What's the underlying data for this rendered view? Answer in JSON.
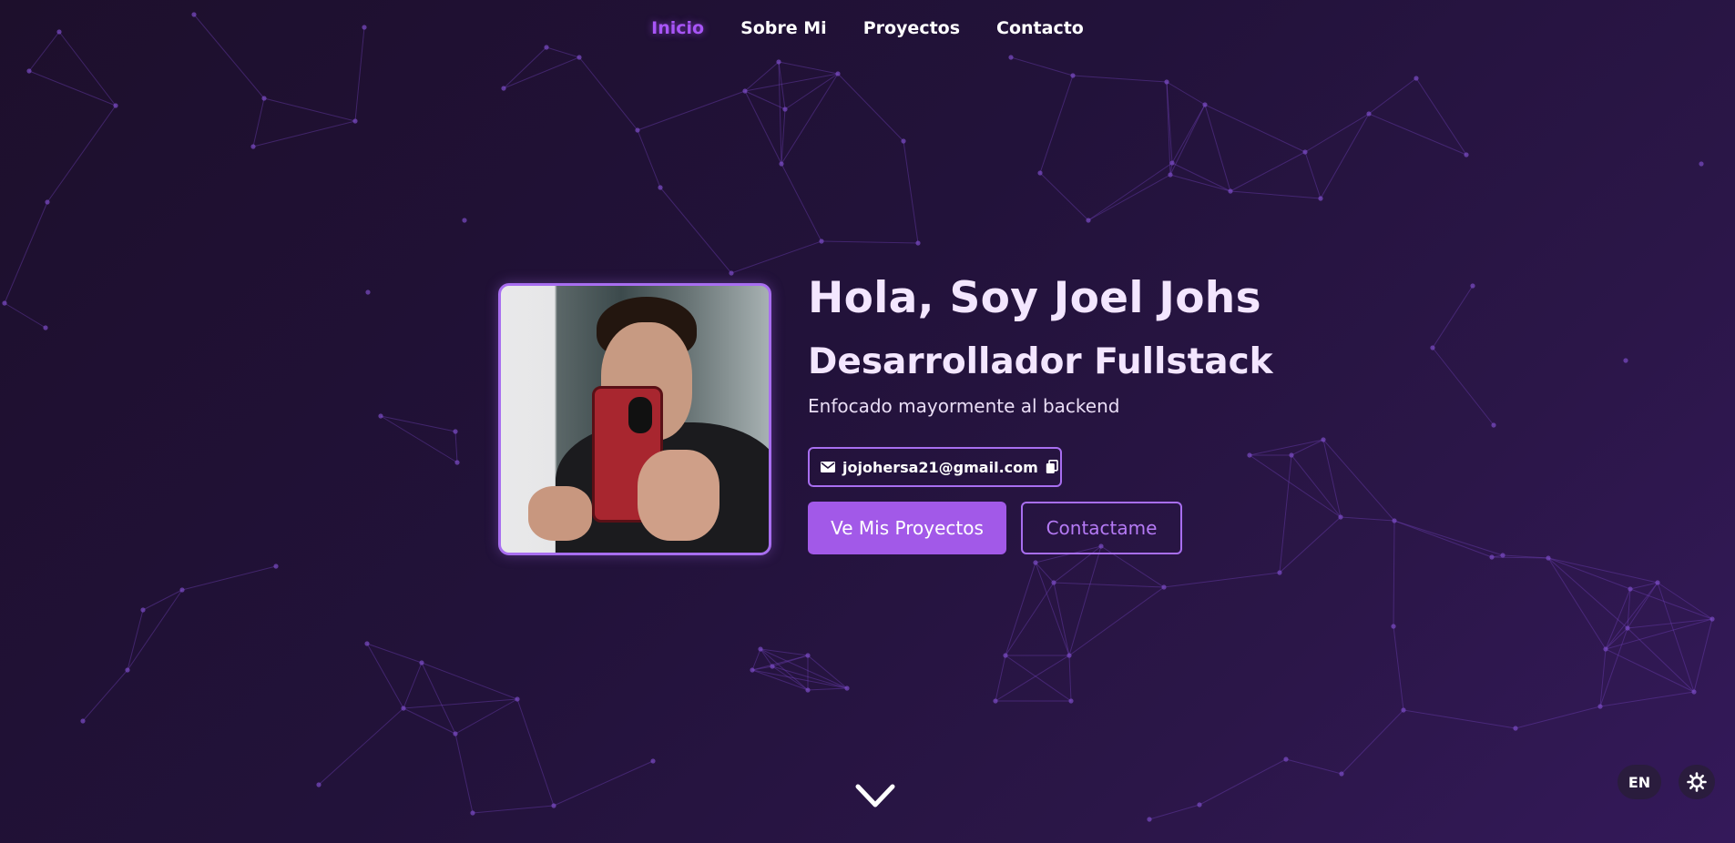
{
  "nav": {
    "items": [
      {
        "label": "Inicio",
        "active": true
      },
      {
        "label": "Sobre Mi",
        "active": false
      },
      {
        "label": "Proyectos",
        "active": false
      },
      {
        "label": "Contacto",
        "active": false
      }
    ]
  },
  "hero": {
    "greeting": "Hola, Soy Joel Johs",
    "role": "Desarrollador Fullstack",
    "tagline": "Enfocado mayormente al backend",
    "email": "jojohersa21@gmail.com",
    "primary_button": "Ve Mis Proyectos",
    "secondary_button": "Contactame"
  },
  "controls": {
    "language_label": "EN"
  },
  "icons": {
    "email": "envelope-icon",
    "copy": "copy-icon",
    "scroll": "chevron-down-icon",
    "theme": "sun-icon"
  },
  "colors": {
    "accent": "#a855f7",
    "button_primary": "#a259e8",
    "border_accent": "#a86ef0",
    "background_dark": "#1d0f2c",
    "background_light": "#34195a"
  }
}
